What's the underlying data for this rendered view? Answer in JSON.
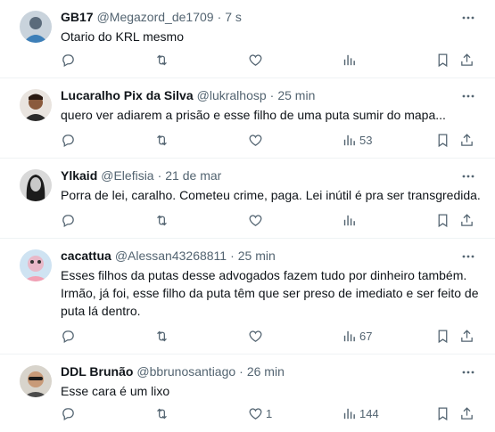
{
  "posts": [
    {
      "name": "GB17",
      "handle": "@Megazord_de1709",
      "time": "7 s",
      "text": "Otario do KRL mesmo",
      "likes": "",
      "views": ""
    },
    {
      "name": "Lucaralho Pix da Silva",
      "handle": "@lukralhosp",
      "time": "25 min",
      "text": "quero ver adiarem a prisão e esse filho de uma puta sumir do mapa...",
      "likes": "",
      "views": "53"
    },
    {
      "name": "Ylkaid",
      "handle": "@Elefisia",
      "time": "21 de mar",
      "text": "Porra de lei, caralho. Cometeu crime, paga. Lei inútil é pra ser transgredida.",
      "likes": "",
      "views": ""
    },
    {
      "name": "cacattua",
      "handle": "@Alessan43268811",
      "time": "25 min",
      "text_lines": [
        "Esses filhos da putas desse advogados fazem tudo por dinheiro também.",
        "Irmão, já foi, esse filho da puta têm que ser preso de imediato e ser feito de",
        "puta lá dentro."
      ],
      "likes": "",
      "views": "67"
    },
    {
      "name": "DDL Brunão",
      "handle": "@bbrunosantiago",
      "time": "26 min",
      "text": "Esse cara é um lixo",
      "likes": "1",
      "views": "144"
    }
  ],
  "separator": "·",
  "colors": {
    "text": "#0f1419",
    "secondary": "#536471",
    "divider": "#eff3f4",
    "background": "#ffffff"
  },
  "icons": [
    "more-icon",
    "reply-icon",
    "retweet-icon",
    "like-icon",
    "views-icon",
    "bookmark-icon",
    "share-icon"
  ]
}
